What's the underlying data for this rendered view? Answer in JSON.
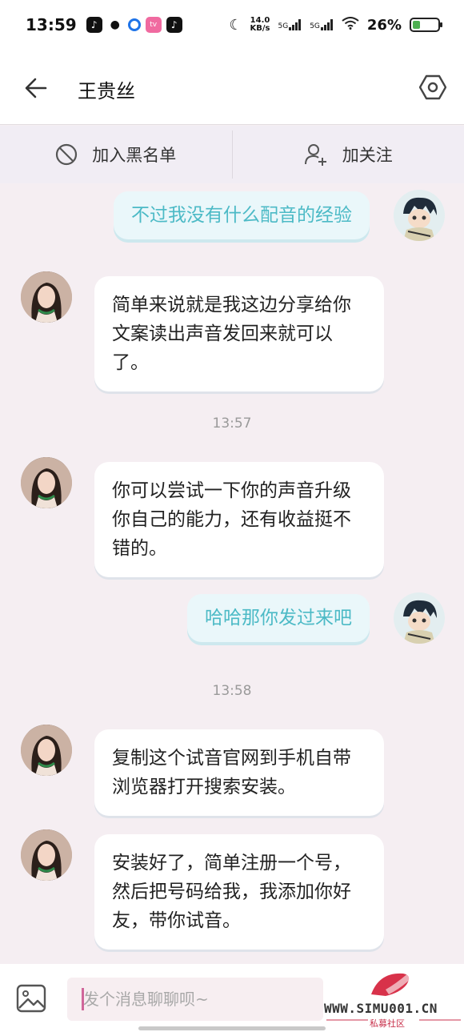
{
  "status_bar": {
    "time": "13:59",
    "net_speed_value": "14.0",
    "net_speed_unit": "KB/s",
    "signal1_label": "5G",
    "signal2_label": "5G",
    "battery": "26%",
    "battery_level": 0.26
  },
  "header": {
    "title": "王贵丝",
    "back_icon": "arrow-left-icon",
    "settings_icon": "hexagon-settings-icon"
  },
  "actions": {
    "blacklist_label": "加入黑名单",
    "follow_label": "加关注"
  },
  "messages": [
    {
      "side": "right",
      "text": "不过我没有什么配音的经验"
    },
    {
      "side": "left",
      "text": "简单来说就是我这边分享给你文案读出声音发回来就可以了。"
    },
    {
      "side": "time",
      "text": "13:57"
    },
    {
      "side": "left",
      "text": "你可以尝试一下你的声音升级你自己的能力，还有收益挺不错的。"
    },
    {
      "side": "right",
      "text": "哈哈那你发过来吧"
    },
    {
      "side": "time",
      "text": "13:58"
    },
    {
      "side": "left",
      "text": "复制这个试音官网到手机自带浏览器打开搜索安装。"
    },
    {
      "side": "left",
      "text": "安装好了，简单注册一个号，然后把号码给我，我添加你好友，带你试音。"
    }
  ],
  "input": {
    "placeholder": "发个消息聊聊呗~"
  },
  "watermark": {
    "site": "WWW.SIMU001.CN",
    "subtitle": "私募社区"
  },
  "colors": {
    "accent_text": "#4cbac6",
    "chat_background": "#f5eef2",
    "right_bubble": "#eaf7fa"
  }
}
